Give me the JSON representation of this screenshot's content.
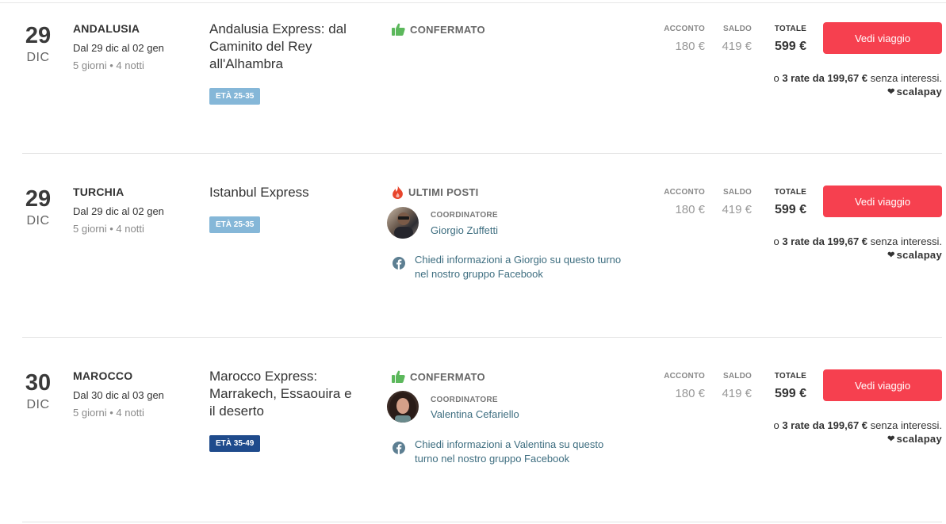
{
  "currency_note": "senza interessi.",
  "trips": [
    {
      "day": "29",
      "month": "DIC",
      "country": "ANDALUSIA",
      "dates": "Dal 29 dic al 02 gen",
      "duration": "5 giorni • 4 notti",
      "title": "Andalusia Express: dal Caminito del Rey all'Alhambra",
      "age": "ETÀ 25-35",
      "status": "CONFERMATO",
      "status_icon": "thumbs-up-icon",
      "acconto_label": "ACCONTO",
      "acconto": "180 €",
      "saldo_label": "SALDO",
      "saldo": "419 €",
      "totale_label": "TOTALE",
      "totale": "599 €",
      "button": "Vedi viaggio",
      "rate_prefix": "o",
      "rate_bold": "3 rate da 199,67 €",
      "rate_suffix": "senza interessi.",
      "scalapay": "scalapay"
    },
    {
      "day": "29",
      "month": "DIC",
      "country": "TURCHIA",
      "dates": "Dal 29 dic al 02 gen",
      "duration": "5 giorni • 4 notti",
      "title": "Istanbul Express",
      "age": "ETÀ 25-35",
      "status": "ULTIMI POSTI",
      "status_icon": "flame-icon",
      "coord_label": "COORDINATORE",
      "coord_name": "Giorgio Zuffetti",
      "fb_text": "Chiedi informazioni a Giorgio su questo turno nel nostro gruppo Facebook",
      "acconto_label": "ACCONTO",
      "acconto": "180 €",
      "saldo_label": "SALDO",
      "saldo": "419 €",
      "totale_label": "TOTALE",
      "totale": "599 €",
      "button": "Vedi viaggio",
      "rate_prefix": "o",
      "rate_bold": "3 rate da 199,67 €",
      "rate_suffix": "senza interessi.",
      "scalapay": "scalapay"
    },
    {
      "day": "30",
      "month": "DIC",
      "country": "MAROCCO",
      "dates": "Dal 30 dic al 03 gen",
      "duration": "5 giorni • 4 notti",
      "title": "Marocco Express: Marrakech, Essaouira e il deserto",
      "age": "ETÀ 35-49",
      "status": "CONFERMATO",
      "status_icon": "thumbs-up-icon",
      "coord_label": "COORDINATORE",
      "coord_name": "Valentina Cefariello",
      "fb_text": "Chiedi informazioni a Valentina su questo turno nel nostro gruppo Facebook",
      "acconto_label": "ACCONTO",
      "acconto": "180 €",
      "saldo_label": "SALDO",
      "saldo": "419 €",
      "totale_label": "TOTALE",
      "totale": "599 €",
      "button": "Vedi viaggio",
      "rate_prefix": "o",
      "rate_bold": "3 rate da 199,67 €",
      "rate_suffix": "senza interessi.",
      "scalapay": "scalapay"
    }
  ],
  "colors": {
    "button": "#f6404f",
    "link": "#3e6e80",
    "thumb": "#5cb85c",
    "flame": "#e8452c",
    "age_light": "#85b7d8",
    "age_dark": "#1f4b8c"
  }
}
